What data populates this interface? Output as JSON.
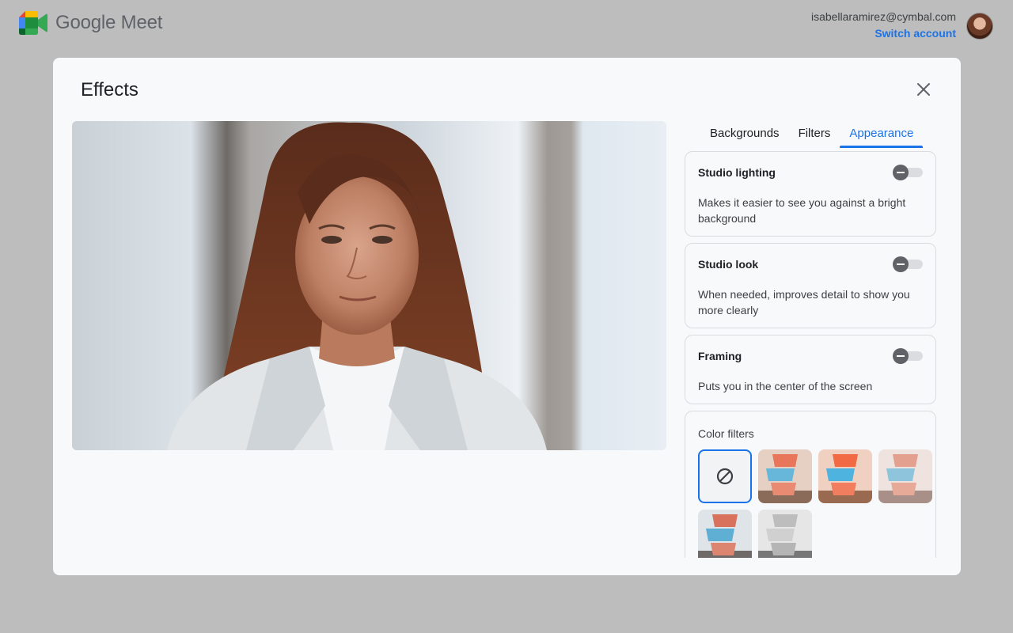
{
  "app": {
    "name": "Google Meet"
  },
  "account": {
    "email": "isabellaramirez@cymbal.com",
    "switch_label": "Switch account"
  },
  "dialog": {
    "title": "Effects"
  },
  "tabs": [
    {
      "label": "Backgrounds",
      "active": false
    },
    {
      "label": "Filters",
      "active": false
    },
    {
      "label": "Appearance",
      "active": true
    }
  ],
  "appearance": {
    "studio_lighting": {
      "title": "Studio lighting",
      "desc": "Makes it easier to see you against a bright background",
      "enabled": false
    },
    "studio_look": {
      "title": "Studio look",
      "desc": "When needed, improves detail to show you more clearly",
      "enabled": false
    },
    "framing": {
      "title": "Framing",
      "desc": "Puts you in the center of the screen",
      "enabled": false
    }
  },
  "color_filters": {
    "title": "Color filters",
    "selected": "none",
    "filters": [
      "none",
      "warm",
      "vivid",
      "soft",
      "cool",
      "black-and-white"
    ]
  },
  "colors": {
    "accent": "#1a73e8",
    "backdrop": "#bdbdbd",
    "dialog": "#f8f9fa"
  }
}
